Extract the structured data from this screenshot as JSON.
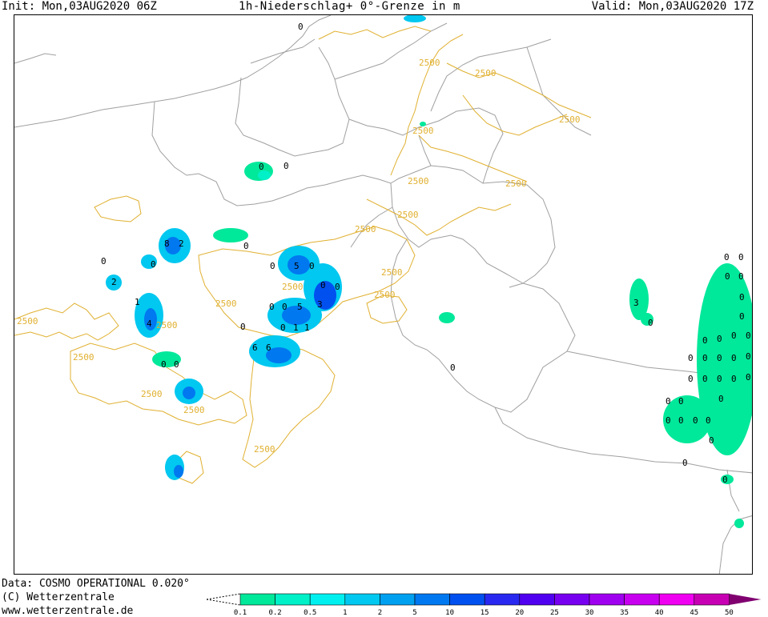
{
  "header": {
    "init": "Init: Mon,03AUG2020 06Z",
    "title": "1h-Niederschlag+ 0°-Grenze in m",
    "valid": "Valid: Mon,03AUG2020 17Z"
  },
  "footer": {
    "data_source": "Data: COSMO OPERATIONAL 0.020°",
    "copyright": "(C) Wetterzentrale",
    "website": "www.wetterzentrale.de"
  },
  "legend": {
    "levels": [
      "0.1",
      "0.2",
      "0.5",
      "1",
      "2",
      "5",
      "10",
      "15",
      "20",
      "25",
      "30",
      "35",
      "40",
      "45",
      "50"
    ],
    "colors": [
      "#00e89a",
      "#00f0c8",
      "#00f0f0",
      "#00c8f0",
      "#00a0f0",
      "#0078f0",
      "#0050f0",
      "#2828f0",
      "#5000f0",
      "#7800f0",
      "#a000f0",
      "#c800f0",
      "#f000f0",
      "#c800b4",
      "#a00090",
      "#800070"
    ]
  },
  "map": {
    "colors": {
      "contour": "#e0b030",
      "border": "#a0a0a0",
      "coast": "#a0a0a0"
    },
    "contour_labels": [
      "2500",
      "2500",
      "2500",
      "2500",
      "2500",
      "2500",
      "2500",
      "2500",
      "2500",
      "2500",
      "2500",
      "2500",
      "2500",
      "2500",
      "2500",
      "2500",
      "2500",
      "2500"
    ],
    "value_labels": [
      "0",
      "0",
      "0",
      "8",
      "2",
      "0",
      "0",
      "2",
      "0",
      "0",
      "5",
      "0",
      "0",
      "0",
      "0",
      "0",
      "5",
      "3",
      "1",
      "4",
      "0",
      "0",
      "1",
      "1",
      "0",
      "6",
      "6",
      "0",
      "0",
      "3",
      "0",
      "0",
      "0",
      "0",
      "0",
      "0",
      "0",
      "0",
      "0",
      "0",
      "0",
      "0",
      "0",
      "0",
      "0",
      "0",
      "0",
      "0",
      "0",
      "0",
      "0",
      "0",
      "0",
      "0",
      "0",
      "0",
      "0",
      "0",
      "0",
      "0",
      "0"
    ]
  }
}
